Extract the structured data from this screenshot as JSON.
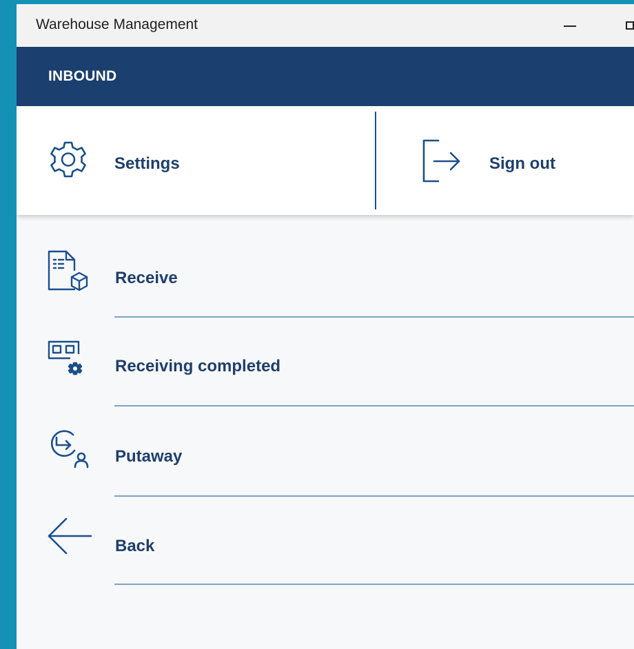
{
  "window": {
    "title": "Warehouse Management"
  },
  "header": {
    "title": "INBOUND"
  },
  "actions": {
    "settings": {
      "label": "Settings",
      "icon": "gear-icon"
    },
    "sign_out": {
      "label": "Sign out",
      "icon": "sign-out-icon"
    }
  },
  "menu": {
    "items": [
      {
        "label": "Receive",
        "icon": "receive-document-box-icon"
      },
      {
        "label": "Receiving completed",
        "icon": "receiving-completed-gear-icon"
      },
      {
        "label": "Putaway",
        "icon": "putaway-arrow-user-icon"
      },
      {
        "label": "Back",
        "icon": "back-arrow-icon"
      }
    ]
  },
  "colors": {
    "accent": "#1b3f6e",
    "label_text": "#1f3f6b",
    "divider": "#7ea1c4",
    "background": "#1591b6"
  }
}
